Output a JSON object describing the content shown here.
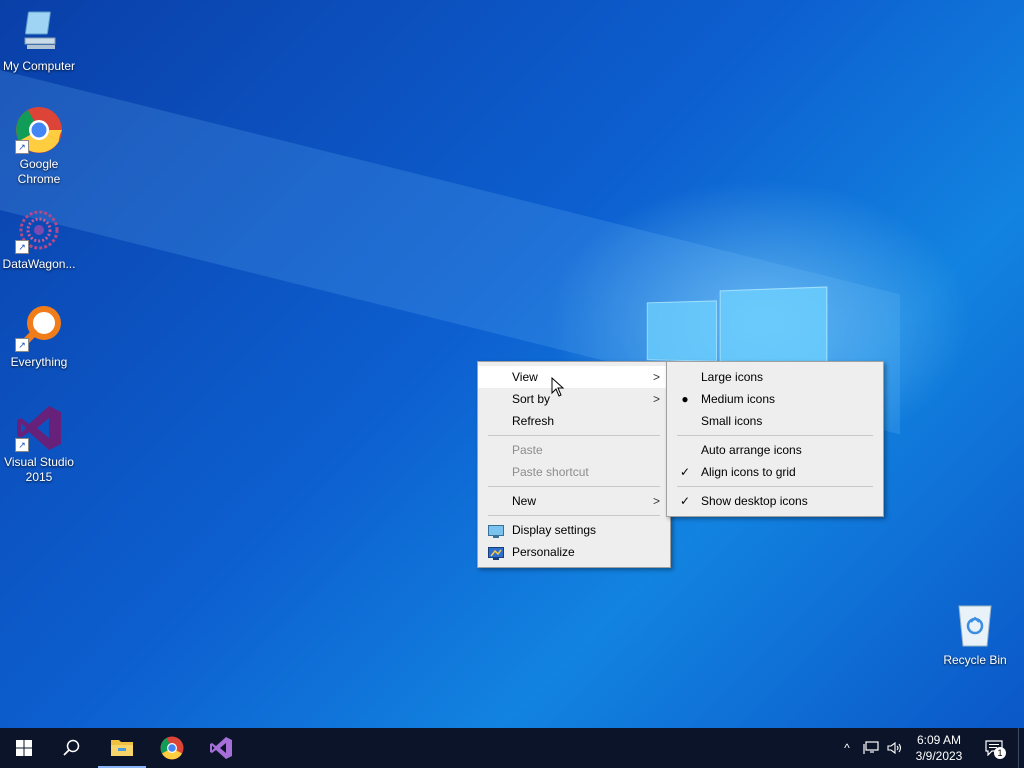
{
  "desktop": {
    "icons": [
      {
        "label": "My Computer"
      },
      {
        "label": "Google Chrome"
      },
      {
        "label": "DataWagon..."
      },
      {
        "label": "Everything"
      },
      {
        "label": "Visual Studio 2015"
      },
      {
        "label": "Recycle Bin"
      }
    ]
  },
  "context_menu": {
    "items": [
      {
        "label": "View"
      },
      {
        "label": "Sort by"
      },
      {
        "label": "Refresh"
      },
      {
        "label": "Paste"
      },
      {
        "label": "Paste shortcut"
      },
      {
        "label": "New"
      },
      {
        "label": "Display settings"
      },
      {
        "label": "Personalize"
      }
    ]
  },
  "view_submenu": {
    "items": [
      {
        "label": "Large icons"
      },
      {
        "label": "Medium icons",
        "state": "selected"
      },
      {
        "label": "Small icons"
      },
      {
        "label": "Auto arrange icons"
      },
      {
        "label": "Align icons to grid",
        "state": "checked"
      },
      {
        "label": "Show desktop icons",
        "state": "checked"
      }
    ]
  },
  "taskbar": {
    "clock_time": "6:09 AM",
    "clock_date": "3/9/2023",
    "notification_count": "1",
    "apps": [
      "start-icon",
      "search-icon",
      "file-explorer-icon",
      "chrome-icon",
      "visual-studio-icon"
    ]
  },
  "colors": {
    "taskbar": "#0b1428",
    "menu_bg": "#eeeeee",
    "desktop_blue": "#0d5fd0",
    "vs_purple": "#68217a"
  }
}
